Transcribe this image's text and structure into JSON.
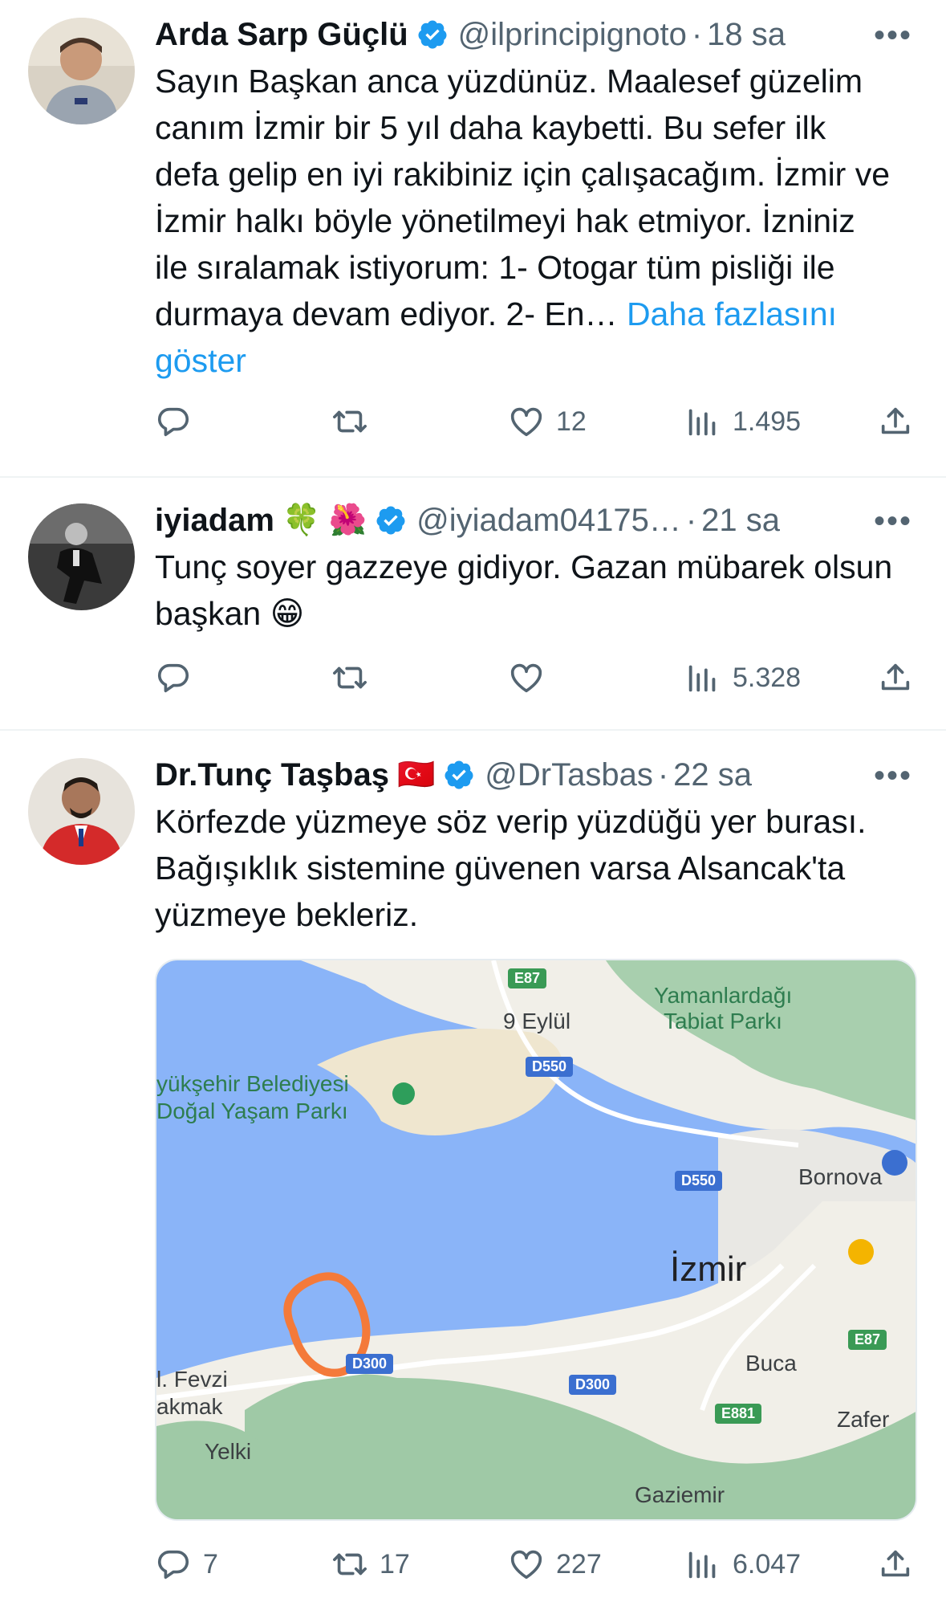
{
  "tweets": [
    {
      "name": "Arda Sarp Güçlü",
      "handle": "@ilprincipignoto",
      "time": "18 sa",
      "text": "Sayın Başkan anca yüzdünüz. Maalesef güzelim canım İzmir bir 5 yıl daha kaybetti. Bu sefer ilk defa gelip en iyi rakibiniz için çalışacağım. İzmir ve İzmir halkı böyle yönetilmeyi hak etmiyor. İzniniz ile sıralamak istiyorum: 1- Otogar tüm pisliği ile durmaya devam ediyor. 2- En… ",
      "show_more": "Daha fazlasını göster",
      "replies": "",
      "retweets": "",
      "likes": "12",
      "views": "1.495"
    },
    {
      "name": "iyiadam",
      "emojis": "🍀 🌺",
      "handle": "@iyiadam04175…",
      "time": "21 sa",
      "text": "Tunç soyer gazzeye gidiyor. Gazan mübarek olsun başkan 😁",
      "replies": "",
      "retweets": "",
      "likes": "",
      "views": "5.328"
    },
    {
      "name": "Dr.Tunç Taşbaş",
      "emojis": "🇹🇷",
      "handle": "@DrTasbas",
      "time": "22 sa",
      "text": "Körfezde yüzmeye söz verip yüzdüğü yer burası. Bağışıklık sistemine güvenen varsa Alsancak'ta yüzmeye bekleriz.",
      "replies": "7",
      "retweets": "17",
      "likes": "227",
      "views": "6.047"
    }
  ],
  "more_label": "•••",
  "separator": "·",
  "map": {
    "labels": {
      "yamanlar1": "Yamanlardağı",
      "yamanlar2": "Tabiat Parkı",
      "dokuz_eylul": "9 Eylül",
      "park1": "yükşehir Belediyesi",
      "park2": "Doğal Yaşam Parkı",
      "bornova": "Bornova",
      "izmir": "İzmir",
      "buca": "Buca",
      "fevzi1": "l. Fevzi",
      "fevzi2": "akmak",
      "yelki": "Yelki",
      "zafer": "Zafer",
      "gaziemir": "Gaziemir"
    },
    "shields": {
      "e87_top": "E87",
      "d550_a": "D550",
      "d550_b": "D550",
      "d300_a": "D300",
      "d300_b": "D300",
      "e87_right": "E87",
      "e881": "E881"
    },
    "colors": {
      "sea": "#8ab4f8",
      "land": "#f1efe8",
      "mountain": "#9fc9a6",
      "annotation": "#f47a3a"
    }
  },
  "colors": {
    "accent": "#1d9bf0",
    "muted": "#536471"
  }
}
